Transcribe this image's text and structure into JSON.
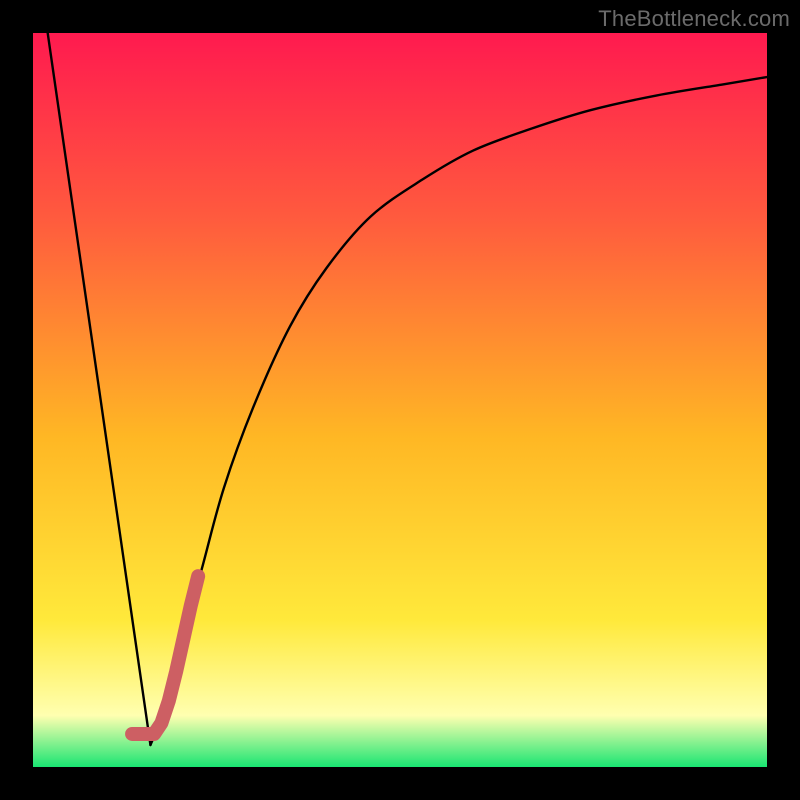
{
  "watermark": "TheBottleneck.com",
  "colors": {
    "frame": "#000000",
    "gradient_top": "#ff1a4f",
    "gradient_upper": "#ff5a3e",
    "gradient_mid": "#ffb724",
    "gradient_lower": "#ffe93b",
    "gradient_pale": "#ffffb0",
    "gradient_green": "#19e572",
    "curve": "#000000",
    "marker": "#cd5f63"
  },
  "chart_data": {
    "type": "line",
    "title": "",
    "xlabel": "",
    "ylabel": "",
    "xlim": [
      0,
      100
    ],
    "ylim": [
      0,
      100
    ],
    "grid": false,
    "legend": false,
    "series": [
      {
        "name": "left-leg",
        "x": [
          2,
          16
        ],
        "values": [
          100,
          3
        ]
      },
      {
        "name": "right-curve",
        "x": [
          16,
          18,
          20,
          23,
          26,
          30,
          35,
          40,
          46,
          53,
          60,
          68,
          76,
          85,
          94,
          100
        ],
        "values": [
          3,
          8,
          16,
          27,
          38,
          49,
          60,
          68,
          75,
          80,
          84,
          87,
          89.5,
          91.5,
          93,
          94
        ]
      },
      {
        "name": "highlight-marker",
        "x": [
          13.5,
          14.5,
          15.5,
          16.5,
          17.5,
          18.5,
          19.5,
          20.5,
          21.5,
          22.5
        ],
        "values": [
          4.5,
          4.5,
          4.5,
          4.5,
          6,
          9,
          13,
          17.5,
          22,
          26
        ]
      }
    ],
    "annotations": []
  }
}
